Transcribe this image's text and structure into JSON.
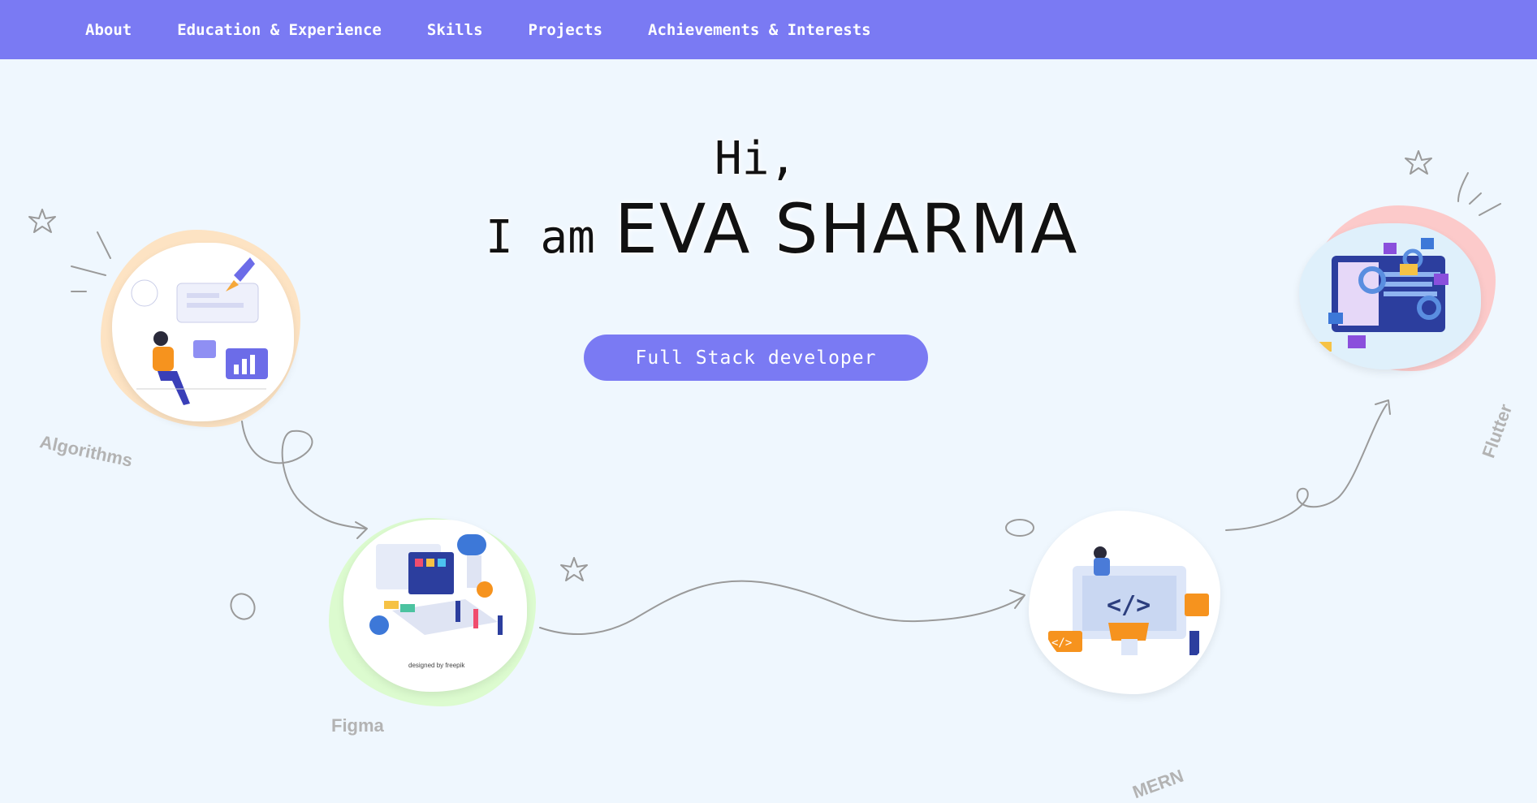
{
  "nav": {
    "items": [
      {
        "label": "About"
      },
      {
        "label": "Education & Experience"
      },
      {
        "label": "Skills"
      },
      {
        "label": "Projects"
      },
      {
        "label": "Achievements & Interests"
      }
    ]
  },
  "hero": {
    "greeting": "Hi,",
    "intro": "I am",
    "name": "EVA SHARMA",
    "role": "Full Stack developer"
  },
  "skills": [
    {
      "label": "Algorithms"
    },
    {
      "label": "Figma"
    },
    {
      "label": "MERN"
    },
    {
      "label": "Flutter"
    }
  ],
  "colors": {
    "accent": "#7a7af3",
    "background": "#eff7fe",
    "blob_algorithms": "#fde3c3",
    "blob_figma": "#dcfbcf",
    "blob_mern": "#ffffff",
    "blob_flutter": "#fccaca"
  }
}
